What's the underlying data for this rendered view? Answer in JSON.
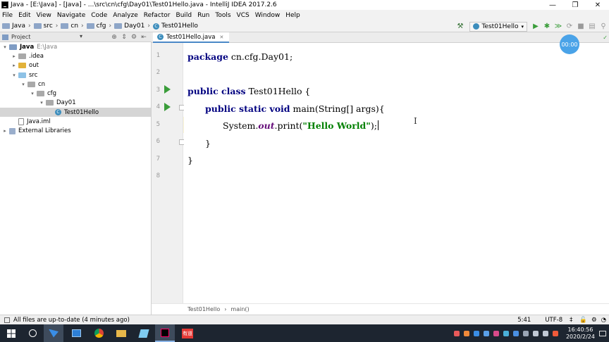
{
  "window": {
    "title": "Java - [E:\\Java] - [Java] - ...\\src\\cn\\cfg\\Day01\\Test01Hello.java - IntelliJ IDEA 2017.2.6",
    "minimize": "—",
    "maximize": "❐",
    "close": "✕"
  },
  "menu": [
    "File",
    "Edit",
    "View",
    "Navigate",
    "Code",
    "Analyze",
    "Refactor",
    "Build",
    "Run",
    "Tools",
    "VCS",
    "Window",
    "Help"
  ],
  "navbar": {
    "crumbs": [
      "Java",
      "src",
      "cn",
      "cfg",
      "Day01",
      "Test01Hello"
    ],
    "run_config": "Test01Hello"
  },
  "project": {
    "title": "Project",
    "tree": [
      {
        "label": "Java",
        "hint": "E:\\Java",
        "depth": 0,
        "arrow": "▾",
        "icon": "blue",
        "bold": true
      },
      {
        "label": ".idea",
        "hint": "",
        "depth": 1,
        "arrow": "▸",
        "icon": "gray"
      },
      {
        "label": "out",
        "hint": "",
        "depth": 1,
        "arrow": "▸",
        "icon": "yellow"
      },
      {
        "label": "src",
        "hint": "",
        "depth": 1,
        "arrow": "▾",
        "icon": "lightblue"
      },
      {
        "label": "cn",
        "hint": "",
        "depth": 2,
        "arrow": "▾",
        "icon": "gray"
      },
      {
        "label": "cfg",
        "hint": "",
        "depth": 3,
        "arrow": "▾",
        "icon": "gray"
      },
      {
        "label": "Day01",
        "hint": "",
        "depth": 4,
        "arrow": "▾",
        "icon": "gray"
      },
      {
        "label": "Test01Hello",
        "hint": "",
        "depth": 5,
        "arrow": "",
        "icon": "class",
        "selected": true
      },
      {
        "label": "Java.iml",
        "hint": "",
        "depth": 1,
        "arrow": "",
        "icon": "file"
      },
      {
        "label": "External Libraries",
        "hint": "",
        "depth": 0,
        "arrow": "▸",
        "icon": "lib"
      }
    ]
  },
  "editor": {
    "tab": "Test01Hello.java",
    "timer": "00:00",
    "line_numbers": [
      "1",
      "2",
      "3",
      "4",
      "5",
      "6",
      "7",
      "8"
    ],
    "code": {
      "l1_kw": "package",
      "l1_rest": " cn.cfg.Day01;",
      "l3_kw": "public class",
      "l3_rest": " Test01Hello {",
      "l4_kw": "public static void",
      "l4_rest": " main(String[] args){",
      "l5_a": "System.",
      "l5_b": "out",
      "l5_c": ".print(",
      "l5_str": "\"Hello World\"",
      "l5_d": ");",
      "l6": "}",
      "l7": "}"
    },
    "crumb_class": "Test01Hello",
    "crumb_method": "main()"
  },
  "status": {
    "message": "All files are up-to-date (4 minutes ago)",
    "position": "5:41",
    "encoding": "UTF-8",
    "encoding_suffix": "‡"
  },
  "taskbar": {
    "time": "16:40:56",
    "date": "2020/2/24",
    "app_label": "有道"
  }
}
